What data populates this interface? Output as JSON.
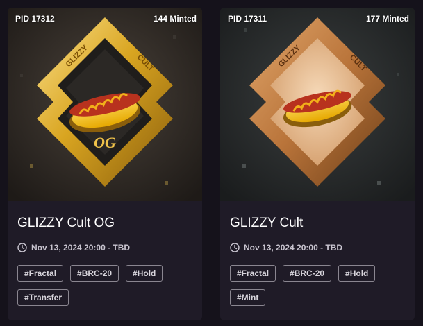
{
  "cards": [
    {
      "pid": "PID 17312",
      "minted": "144 Minted",
      "title": "GLIZZY Cult OG",
      "date": "Nov 13, 2024 20:00 - TBD",
      "art": {
        "frame_word_left": "GLIZZY",
        "frame_word_right": "CULT",
        "badge": "OG",
        "frame_color": "#d9a521",
        "background": "#2a2520"
      },
      "tags": [
        "#Fractal",
        "#BRC-20",
        "#Hold",
        "#Transfer"
      ]
    },
    {
      "pid": "PID 17311",
      "minted": "177 Minted",
      "title": "GLIZZY Cult",
      "date": "Nov 13, 2024 20:00 - TBD",
      "art": {
        "frame_word_left": "GLIZZY",
        "frame_word_right": "CULT",
        "badge": "",
        "frame_color": "#b9743a",
        "background": "#232626"
      },
      "tags": [
        "#Fractal",
        "#BRC-20",
        "#Hold",
        "#Mint"
      ]
    }
  ],
  "colors": {
    "page_bg": "#15121b",
    "card_bg": "#1f1b27",
    "tag_border": "#8a8690",
    "muted_text": "#c9c5d0"
  },
  "icons": {
    "date": "clock-icon"
  }
}
